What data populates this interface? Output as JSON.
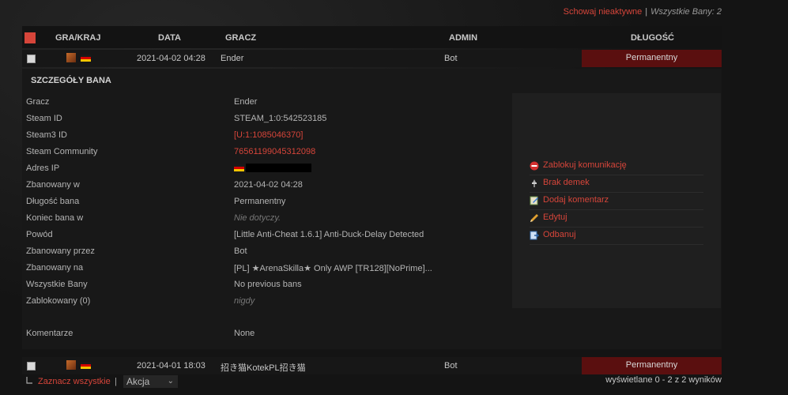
{
  "topbar": {
    "hide_inactive": "Schowaj nieaktywne",
    "separator": "|",
    "all_bans": "Wszystkie Bany: 2"
  },
  "header": {
    "game_country": "GRA/KRAJ",
    "date": "DATA",
    "player": "GRACZ",
    "admin": "ADMIN",
    "length": "DŁUGOŚĆ"
  },
  "rows": [
    {
      "date": "2021-04-02 04:28",
      "player": "Ender",
      "admin": "Bot",
      "length": "Permanentny"
    },
    {
      "date": "2021-04-01 18:03",
      "player": "招き猫KotekPL招き猫",
      "admin": "Bot",
      "length": "Permanentny"
    }
  ],
  "details": {
    "title": "SZCZEGÓŁY BANA",
    "fields": [
      {
        "label": "Gracz",
        "value": "Ender"
      },
      {
        "label": "Steam ID",
        "value": "STEAM_1:0:542523185"
      },
      {
        "label": "Steam3 ID",
        "value": "[U:1:1085046370]"
      },
      {
        "label": "Steam Community",
        "value": "76561199045312098"
      },
      {
        "label": "Adres IP",
        "value": ""
      },
      {
        "label": "Zbanowany w",
        "value": "2021-04-02 04:28"
      },
      {
        "label": "Długość bana",
        "value": "Permanentny"
      },
      {
        "label": "Koniec bana w",
        "value": "Nie dotyczy."
      },
      {
        "label": "Powód",
        "value": "[Little Anti-Cheat 1.6.1] Anti-Duck-Delay Detected"
      },
      {
        "label": "Zbanowany przez",
        "value": "Bot"
      },
      {
        "label": "Zbanowany na",
        "value": "[PL] ★ArenaSkilla★ Only AWP [TR128][NoPrime]..."
      },
      {
        "label": "Wszystkie Bany",
        "value": "No previous bans"
      },
      {
        "label": "Zablokowany (0)",
        "value": "nigdy"
      },
      {
        "label": "Komentarze",
        "value": "None"
      }
    ],
    "actions": [
      {
        "label": "Zablokuj komunikację",
        "icon": "block-icon"
      },
      {
        "label": "Brak demek",
        "icon": "demo-icon"
      },
      {
        "label": "Dodaj komentarz",
        "icon": "comment-icon"
      },
      {
        "label": "Edytuj",
        "icon": "edit-icon"
      },
      {
        "label": "Odbanuj",
        "icon": "unban-icon"
      }
    ]
  },
  "footer": {
    "select_all": "Zaznacz wszystkie",
    "separator": "|",
    "action": "Akcja",
    "showing": "wyświetlane 0 - 2 z 2 wyników"
  },
  "colors": {
    "accent": "#d6453a",
    "permanent_bg": "#5a0f0f"
  }
}
